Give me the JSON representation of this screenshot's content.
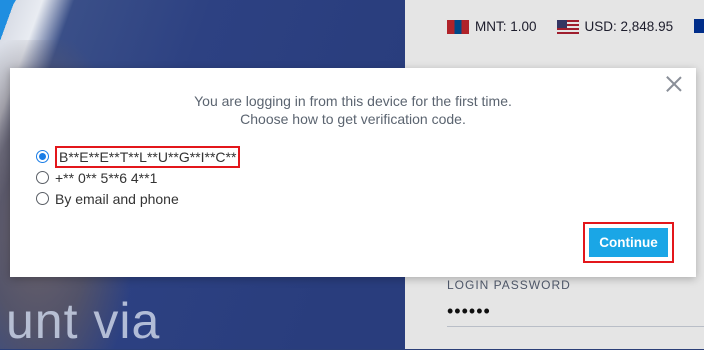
{
  "header": {
    "rates": [
      {
        "flag": "mongolia-flag-icon",
        "label": "MNT: 1.00"
      },
      {
        "flag": "usa-flag-icon",
        "label": "USD: 2,848.95"
      }
    ]
  },
  "hero": {
    "text": "unt via"
  },
  "login": {
    "password_label": "LOGIN PASSWORD",
    "password_value": "••••••"
  },
  "modal": {
    "line1": "You are logging in from this device for the first time.",
    "line2": "Choose how to get verification code.",
    "options": [
      {
        "label": "B**E**E**T**L**U**G**I**C**",
        "checked": true
      },
      {
        "label": "+** 0** 5**6 4**1",
        "checked": false
      },
      {
        "label": "By email and phone",
        "checked": false
      }
    ],
    "continue_label": "Continue"
  },
  "colors": {
    "accent": "#1aa6e6",
    "highlight_box": "#e3161b",
    "radio_selected": "#1a7de6"
  }
}
